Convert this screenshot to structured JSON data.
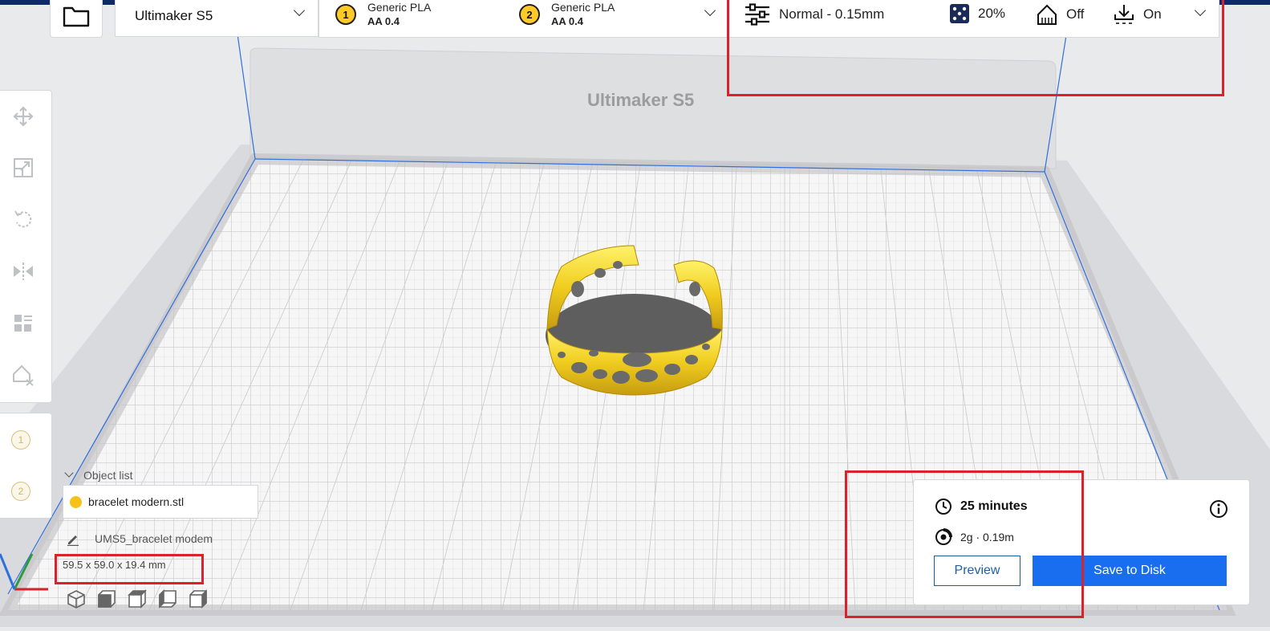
{
  "toolbar": {
    "printer_name": "Ultimaker S5",
    "extruders": [
      {
        "number": "1",
        "material": "Generic PLA",
        "core": "AA 0.4"
      },
      {
        "number": "2",
        "material": "Generic PLA",
        "core": "AA 0.4"
      }
    ],
    "settings": {
      "profile": "Normal - 0.15mm",
      "infill": "20%",
      "support": "Off",
      "adhesion": "On"
    }
  },
  "build_plate": {
    "printer_label": "Ultimaker S5"
  },
  "object_list": {
    "header": "Object list",
    "items": [
      {
        "name": "bracelet modern.stl",
        "color": "#f6c21a"
      }
    ],
    "job_name": "UMS5_bracelet modem",
    "dimensions": "59.5 x 59.0 x 19.4 mm"
  },
  "extruder_indicators": [
    "1",
    "2"
  ],
  "output": {
    "print_time": "25 minutes",
    "material_usage": "2g · 0.19m",
    "preview_label": "Preview",
    "save_label": "Save to Disk"
  },
  "colors": {
    "accent": "#196ef0",
    "highlight": "#d9222e",
    "model": "#f3d229",
    "grid_border": "#2f6fe0"
  },
  "icons": {
    "folder": "folder-icon",
    "settings": "sliders-icon",
    "infill": "infill-icon",
    "support": "support-icon",
    "adhesion": "adhesion-icon",
    "clock": "clock-icon",
    "spool": "spool-icon",
    "info": "info-icon"
  }
}
